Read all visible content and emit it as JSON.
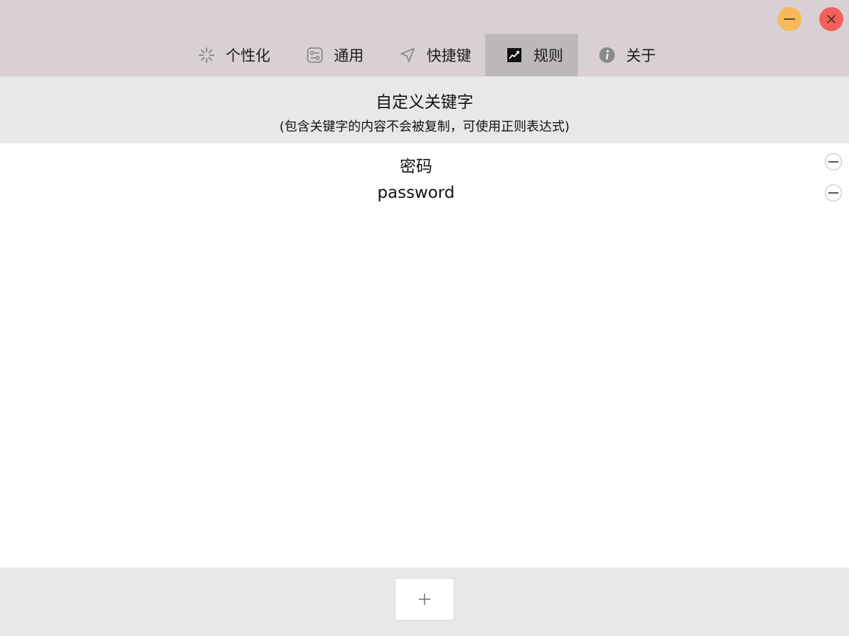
{
  "window": {
    "controls": {
      "minimize_icon": "minimize-icon",
      "close_icon": "close-icon",
      "minimize_color": "#f8b95a",
      "close_color": "#f4605a"
    }
  },
  "tabs": [
    {
      "label": "个性化",
      "icon": "spinner-icon",
      "active": false
    },
    {
      "label": "通用",
      "icon": "sliders-icon",
      "active": false
    },
    {
      "label": "快捷键",
      "icon": "navigation-arrow-icon",
      "active": false
    },
    {
      "label": "规则",
      "icon": "chart-icon",
      "active": true
    },
    {
      "label": "关于",
      "icon": "info-icon",
      "active": false
    }
  ],
  "header": {
    "title": "自定义关键字",
    "subtitle": "(包含关键字的内容不会被复制，可使用正则表达式)"
  },
  "rules": [
    {
      "text": "密码"
    },
    {
      "text": "password"
    }
  ],
  "footer": {
    "add_icon": "plus-icon"
  },
  "colors": {
    "titlebar_bg": "#d8d0d5",
    "active_tab_bg": "#bdb8bc",
    "header_bg": "#e8e8e8",
    "footer_bg": "#e8e8e8"
  }
}
